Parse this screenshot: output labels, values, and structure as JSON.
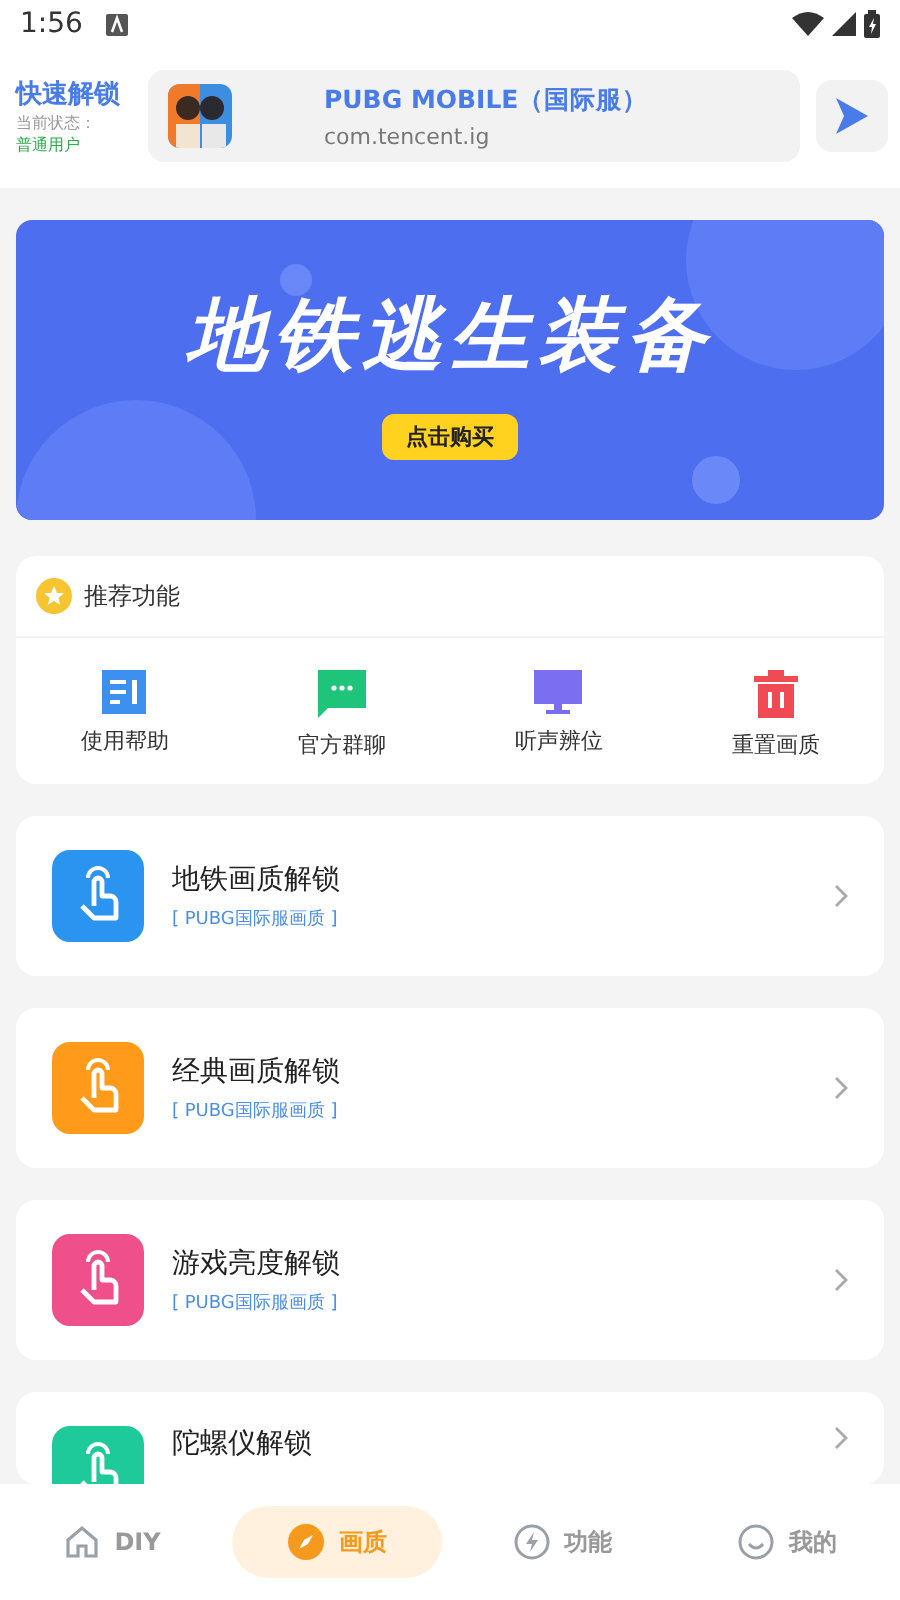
{
  "status_bar": {
    "time": "1:56"
  },
  "header": {
    "title": "快速解锁",
    "status_label": "当前状态：",
    "status_value": "普通用户",
    "app": {
      "name": "PUBG MOBILE（国际服）",
      "package": "com.tencent.ig"
    }
  },
  "banner": {
    "headline": "地铁逃生装备",
    "button": "点击购买"
  },
  "recommended": {
    "title": "推荐功能",
    "items": [
      {
        "label": "使用帮助",
        "kind": "doc",
        "color": "#3d8ff0"
      },
      {
        "label": "官方群聊",
        "kind": "chat",
        "color": "#1ec47a"
      },
      {
        "label": "听声辨位",
        "kind": "monitor",
        "color": "#7a6ff0"
      },
      {
        "label": "重置画质",
        "kind": "trash",
        "color": "#f04a55"
      }
    ]
  },
  "features": [
    {
      "title": "地铁画质解锁",
      "subtitle": "[ PUBG国际服画质 ]",
      "color": "#2b93f0"
    },
    {
      "title": "经典画质解锁",
      "subtitle": "[ PUBG国际服画质 ]",
      "color": "#ff9a1a"
    },
    {
      "title": "游戏亮度解锁",
      "subtitle": "[ PUBG国际服画质 ]",
      "color": "#ef4f8a"
    },
    {
      "title": "陀螺仪解锁",
      "color": "#1ec99a"
    }
  ],
  "nav": [
    {
      "label": "DIY",
      "kind": "home",
      "selected": false
    },
    {
      "label": "画质",
      "kind": "compass",
      "selected": true
    },
    {
      "label": "功能",
      "kind": "bolt",
      "selected": false
    },
    {
      "label": "我的",
      "kind": "smile",
      "selected": false
    }
  ]
}
